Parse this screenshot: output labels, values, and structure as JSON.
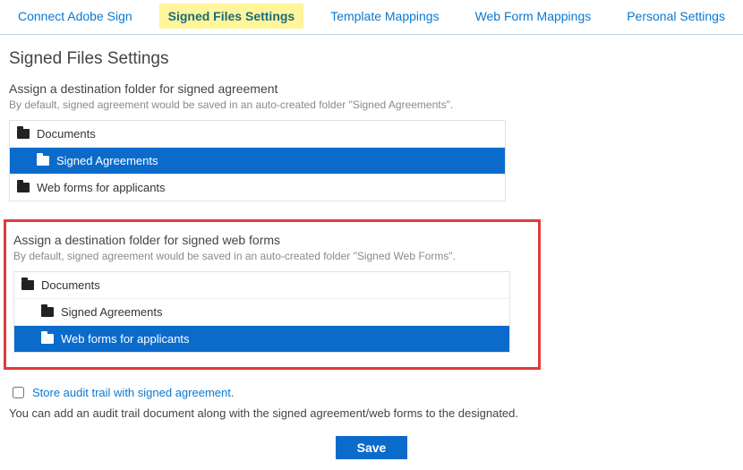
{
  "tabs": [
    {
      "label": "Connect Adobe Sign",
      "active": false
    },
    {
      "label": "Signed Files Settings",
      "active": true
    },
    {
      "label": "Template Mappings",
      "active": false
    },
    {
      "label": "Web Form Mappings",
      "active": false
    },
    {
      "label": "Personal Settings",
      "active": false
    }
  ],
  "page_title": "Signed Files Settings",
  "section1": {
    "title": "Assign a destination folder for signed agreement",
    "help": "By default, signed agreement would be saved in an auto-created folder \"Signed Agreements\".",
    "items": [
      {
        "label": "Documents",
        "indent": 0,
        "selected": false
      },
      {
        "label": "Signed Agreements",
        "indent": 1,
        "selected": true
      },
      {
        "label": "Web forms for applicants",
        "indent": 0,
        "selected": false
      }
    ]
  },
  "section2": {
    "title": "Assign a destination folder for signed web forms",
    "help": "By default, signed agreement would be saved in an auto-created folder \"Signed Web Forms\".",
    "items": [
      {
        "label": "Documents",
        "indent": 0,
        "selected": false
      },
      {
        "label": "Signed Agreements",
        "indent": 1,
        "selected": false
      },
      {
        "label": "Web forms for applicants",
        "indent": 1,
        "selected": true
      }
    ]
  },
  "audit": {
    "checkbox_label": "Store audit trail with signed agreement.",
    "checked": false,
    "help": "You can add an audit trail document along with the signed agreement/web forms to the designated."
  },
  "save_label": "Save"
}
